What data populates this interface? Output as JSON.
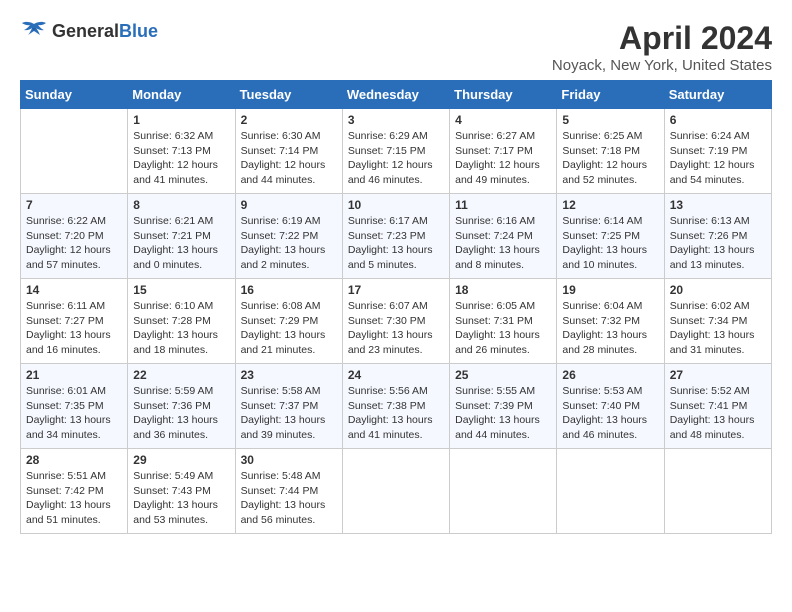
{
  "header": {
    "logo_general": "General",
    "logo_blue": "Blue",
    "title": "April 2024",
    "subtitle": "Noyack, New York, United States"
  },
  "days_of_week": [
    "Sunday",
    "Monday",
    "Tuesday",
    "Wednesday",
    "Thursday",
    "Friday",
    "Saturday"
  ],
  "weeks": [
    [
      {
        "day": "",
        "info": ""
      },
      {
        "day": "1",
        "info": "Sunrise: 6:32 AM\nSunset: 7:13 PM\nDaylight: 12 hours\nand 41 minutes."
      },
      {
        "day": "2",
        "info": "Sunrise: 6:30 AM\nSunset: 7:14 PM\nDaylight: 12 hours\nand 44 minutes."
      },
      {
        "day": "3",
        "info": "Sunrise: 6:29 AM\nSunset: 7:15 PM\nDaylight: 12 hours\nand 46 minutes."
      },
      {
        "day": "4",
        "info": "Sunrise: 6:27 AM\nSunset: 7:17 PM\nDaylight: 12 hours\nand 49 minutes."
      },
      {
        "day": "5",
        "info": "Sunrise: 6:25 AM\nSunset: 7:18 PM\nDaylight: 12 hours\nand 52 minutes."
      },
      {
        "day": "6",
        "info": "Sunrise: 6:24 AM\nSunset: 7:19 PM\nDaylight: 12 hours\nand 54 minutes."
      }
    ],
    [
      {
        "day": "7",
        "info": "Sunrise: 6:22 AM\nSunset: 7:20 PM\nDaylight: 12 hours\nand 57 minutes."
      },
      {
        "day": "8",
        "info": "Sunrise: 6:21 AM\nSunset: 7:21 PM\nDaylight: 13 hours\nand 0 minutes."
      },
      {
        "day": "9",
        "info": "Sunrise: 6:19 AM\nSunset: 7:22 PM\nDaylight: 13 hours\nand 2 minutes."
      },
      {
        "day": "10",
        "info": "Sunrise: 6:17 AM\nSunset: 7:23 PM\nDaylight: 13 hours\nand 5 minutes."
      },
      {
        "day": "11",
        "info": "Sunrise: 6:16 AM\nSunset: 7:24 PM\nDaylight: 13 hours\nand 8 minutes."
      },
      {
        "day": "12",
        "info": "Sunrise: 6:14 AM\nSunset: 7:25 PM\nDaylight: 13 hours\nand 10 minutes."
      },
      {
        "day": "13",
        "info": "Sunrise: 6:13 AM\nSunset: 7:26 PM\nDaylight: 13 hours\nand 13 minutes."
      }
    ],
    [
      {
        "day": "14",
        "info": "Sunrise: 6:11 AM\nSunset: 7:27 PM\nDaylight: 13 hours\nand 16 minutes."
      },
      {
        "day": "15",
        "info": "Sunrise: 6:10 AM\nSunset: 7:28 PM\nDaylight: 13 hours\nand 18 minutes."
      },
      {
        "day": "16",
        "info": "Sunrise: 6:08 AM\nSunset: 7:29 PM\nDaylight: 13 hours\nand 21 minutes."
      },
      {
        "day": "17",
        "info": "Sunrise: 6:07 AM\nSunset: 7:30 PM\nDaylight: 13 hours\nand 23 minutes."
      },
      {
        "day": "18",
        "info": "Sunrise: 6:05 AM\nSunset: 7:31 PM\nDaylight: 13 hours\nand 26 minutes."
      },
      {
        "day": "19",
        "info": "Sunrise: 6:04 AM\nSunset: 7:32 PM\nDaylight: 13 hours\nand 28 minutes."
      },
      {
        "day": "20",
        "info": "Sunrise: 6:02 AM\nSunset: 7:34 PM\nDaylight: 13 hours\nand 31 minutes."
      }
    ],
    [
      {
        "day": "21",
        "info": "Sunrise: 6:01 AM\nSunset: 7:35 PM\nDaylight: 13 hours\nand 34 minutes."
      },
      {
        "day": "22",
        "info": "Sunrise: 5:59 AM\nSunset: 7:36 PM\nDaylight: 13 hours\nand 36 minutes."
      },
      {
        "day": "23",
        "info": "Sunrise: 5:58 AM\nSunset: 7:37 PM\nDaylight: 13 hours\nand 39 minutes."
      },
      {
        "day": "24",
        "info": "Sunrise: 5:56 AM\nSunset: 7:38 PM\nDaylight: 13 hours\nand 41 minutes."
      },
      {
        "day": "25",
        "info": "Sunrise: 5:55 AM\nSunset: 7:39 PM\nDaylight: 13 hours\nand 44 minutes."
      },
      {
        "day": "26",
        "info": "Sunrise: 5:53 AM\nSunset: 7:40 PM\nDaylight: 13 hours\nand 46 minutes."
      },
      {
        "day": "27",
        "info": "Sunrise: 5:52 AM\nSunset: 7:41 PM\nDaylight: 13 hours\nand 48 minutes."
      }
    ],
    [
      {
        "day": "28",
        "info": "Sunrise: 5:51 AM\nSunset: 7:42 PM\nDaylight: 13 hours\nand 51 minutes."
      },
      {
        "day": "29",
        "info": "Sunrise: 5:49 AM\nSunset: 7:43 PM\nDaylight: 13 hours\nand 53 minutes."
      },
      {
        "day": "30",
        "info": "Sunrise: 5:48 AM\nSunset: 7:44 PM\nDaylight: 13 hours\nand 56 minutes."
      },
      {
        "day": "",
        "info": ""
      },
      {
        "day": "",
        "info": ""
      },
      {
        "day": "",
        "info": ""
      },
      {
        "day": "",
        "info": ""
      }
    ]
  ]
}
